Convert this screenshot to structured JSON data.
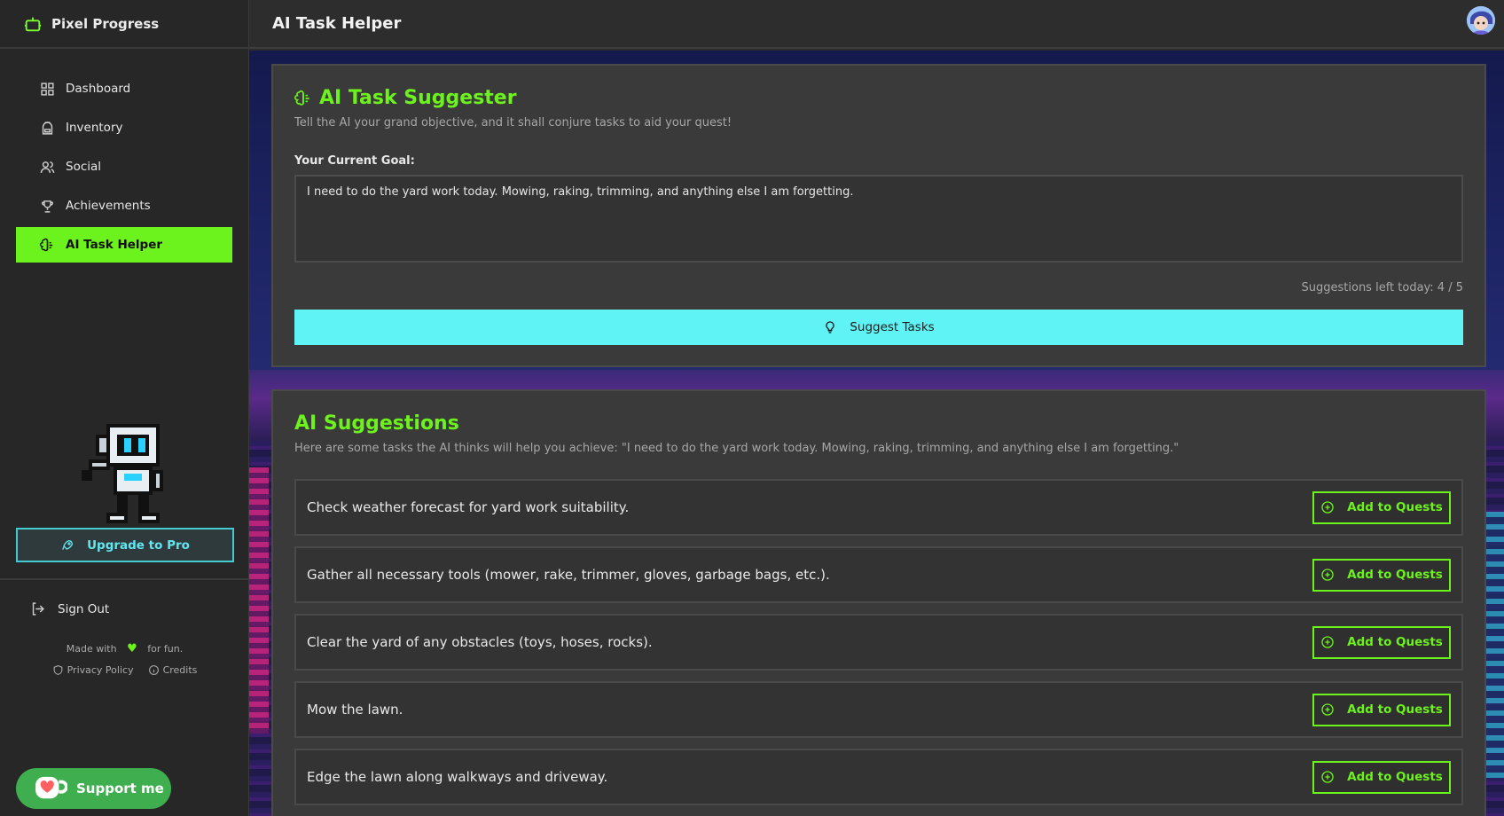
{
  "app": {
    "brand": "Pixel Progress"
  },
  "sidebar": {
    "items": [
      {
        "label": "Dashboard",
        "icon": "dashboard-icon"
      },
      {
        "label": "Inventory",
        "icon": "backpack-icon"
      },
      {
        "label": "Social",
        "icon": "users-icon"
      },
      {
        "label": "Achievements",
        "icon": "trophy-icon"
      },
      {
        "label": "AI Task Helper",
        "icon": "brain-icon",
        "active": true
      }
    ],
    "upgrade_label": "Upgrade to Pro",
    "signout_label": "Sign Out",
    "made_with_prefix": "Made with",
    "made_with_suffix": "for fun.",
    "privacy_label": "Privacy Policy",
    "credits_label": "Credits",
    "support_label": "Support me"
  },
  "header": {
    "title": "AI Task Helper"
  },
  "suggester": {
    "title": "AI Task Suggester",
    "subtitle": "Tell the AI your grand objective, and it shall conjure tasks to aid your quest!",
    "goal_label": "Your Current Goal:",
    "goal_value": "I need to do the yard work today. Mowing, raking, trimming, and anything else I am forgetting.",
    "remaining": "Suggestions left today: 4 / 5",
    "button_label": "Suggest Tasks"
  },
  "suggestions": {
    "title": "AI Suggestions",
    "subtitle": "Here are some tasks the AI thinks will help you achieve: \"I need to do the yard work today. Mowing, raking, trimming, and anything else I am forgetting.\"",
    "add_label": "Add to Quests",
    "items": [
      "Check weather forecast for yard work suitability.",
      "Gather all necessary tools (mower, rake, trimmer, gloves, garbage bags, etc.).",
      "Clear the yard of any obstacles (toys, hoses, rocks).",
      "Mow the lawn.",
      "Edge the lawn along walkways and driveway."
    ]
  },
  "colors": {
    "accent_green": "#6cf21c",
    "accent_cyan": "#5ff3f5",
    "panel": "#3a3a3a",
    "sidebar": "#272727"
  }
}
